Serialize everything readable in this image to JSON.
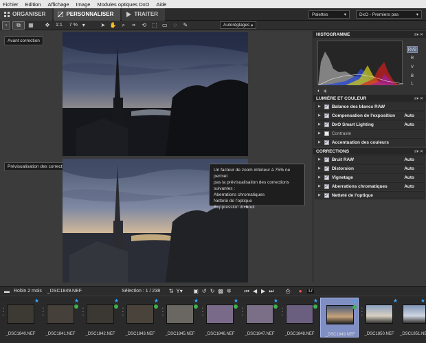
{
  "menu": [
    "Fichier",
    "Edition",
    "Affichage",
    "Image",
    "Modules optiques DxO",
    "Aide"
  ],
  "tabs": [
    {
      "label": "ORGANISER",
      "active": false
    },
    {
      "label": "PERSONNALISER",
      "active": true
    },
    {
      "label": "TRAITER",
      "active": false
    }
  ],
  "palettes_label": "Palettes",
  "preset_label": "DxO - Premiers pas",
  "toolbar": {
    "ratio": "1:1",
    "zoom": "7 %",
    "auto_label": "Autoréglages"
  },
  "viewer": {
    "before_label": "Avant correction",
    "after_label": "Prévisualisation des corrections",
    "tooltip_lines": [
      "Un facteur de zoom inférieur à 75% ne permet",
      "pas la prévisualisation des corrections",
      "suivantes :",
      "Aberrations chromatiques",
      "Netteté de l'optique",
      "Suppression du bruit"
    ]
  },
  "panel": {
    "histogram_title": "HISTOGRAMME",
    "channels": [
      "RVB",
      "R",
      "V",
      "B",
      "L"
    ],
    "section1_title": "LUMIÈRE ET COULEUR",
    "section1_rows": [
      {
        "label": "Balance des blancs RAW",
        "checked": true,
        "auto": ""
      },
      {
        "label": "Compensation de l'exposition",
        "checked": true,
        "auto": "Auto"
      },
      {
        "label": "DxO Smart Lighting",
        "checked": true,
        "auto": "Auto"
      },
      {
        "label": "Contraste",
        "checked": false,
        "auto": ""
      },
      {
        "label": "Accentuation des couleurs",
        "checked": true,
        "auto": ""
      }
    ],
    "section2_title": "CORRECTIONS",
    "section2_rows": [
      {
        "label": "Bruit RAW",
        "checked": true,
        "auto": "Auto"
      },
      {
        "label": "Distorsion",
        "checked": true,
        "auto": "Auto"
      },
      {
        "label": "Vignetage",
        "checked": true,
        "auto": "Auto"
      },
      {
        "label": "Aberrations chromatiques",
        "checked": true,
        "auto": "Auto"
      },
      {
        "label": "Netteté de l'optique",
        "checked": true,
        "auto": ""
      }
    ]
  },
  "filmstrip": {
    "project": "Robin 2 mois",
    "current_file": "_DSC1849.NEF",
    "selection": "Sélection : 1 / 238",
    "lr_label": "Lr",
    "thumbs": [
      {
        "name": "_DSC1840.NEF",
        "color": "#3d3a34"
      },
      {
        "name": "_DSC1841.NEF",
        "color": "#45403a"
      },
      {
        "name": "_DSC1842.NEF",
        "color": "#3b3834"
      },
      {
        "name": "_DSC1843.NEF",
        "color": "#4a433c"
      },
      {
        "name": "_DSC1845.NEF",
        "color": "#6a6762"
      },
      {
        "name": "_DSC1846.NEF",
        "color": "#7a6a8a"
      },
      {
        "name": "_DSC1847.NEF",
        "color": "#7a6f86"
      },
      {
        "name": "_DSC1848.NEF",
        "color": "#6b5f80"
      },
      {
        "name": "_DSC1849.NEF",
        "color": "#4b5a7a"
      },
      {
        "name": "_DSC1850.NEF",
        "color": "#8aa0c0"
      },
      {
        "name": "_DSC1851.NEF",
        "color": "#7f95b8"
      }
    ]
  }
}
